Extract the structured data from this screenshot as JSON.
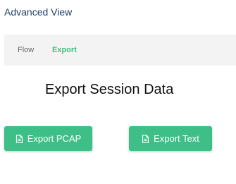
{
  "header": {
    "title": "Advanced View"
  },
  "tabs": [
    {
      "label": "Flow",
      "active": false
    },
    {
      "label": "Export",
      "active": true
    }
  ],
  "main": {
    "heading": "Export Session Data",
    "buttons": [
      {
        "label": "Export PCAP",
        "icon": "document-icon"
      },
      {
        "label": "Export Text",
        "icon": "document-icon"
      }
    ]
  },
  "colors": {
    "accent": "#3ebf88",
    "active_tab": "#3cbf82",
    "title": "#1f3f68",
    "tabbar_bg": "#f3f3f3"
  }
}
